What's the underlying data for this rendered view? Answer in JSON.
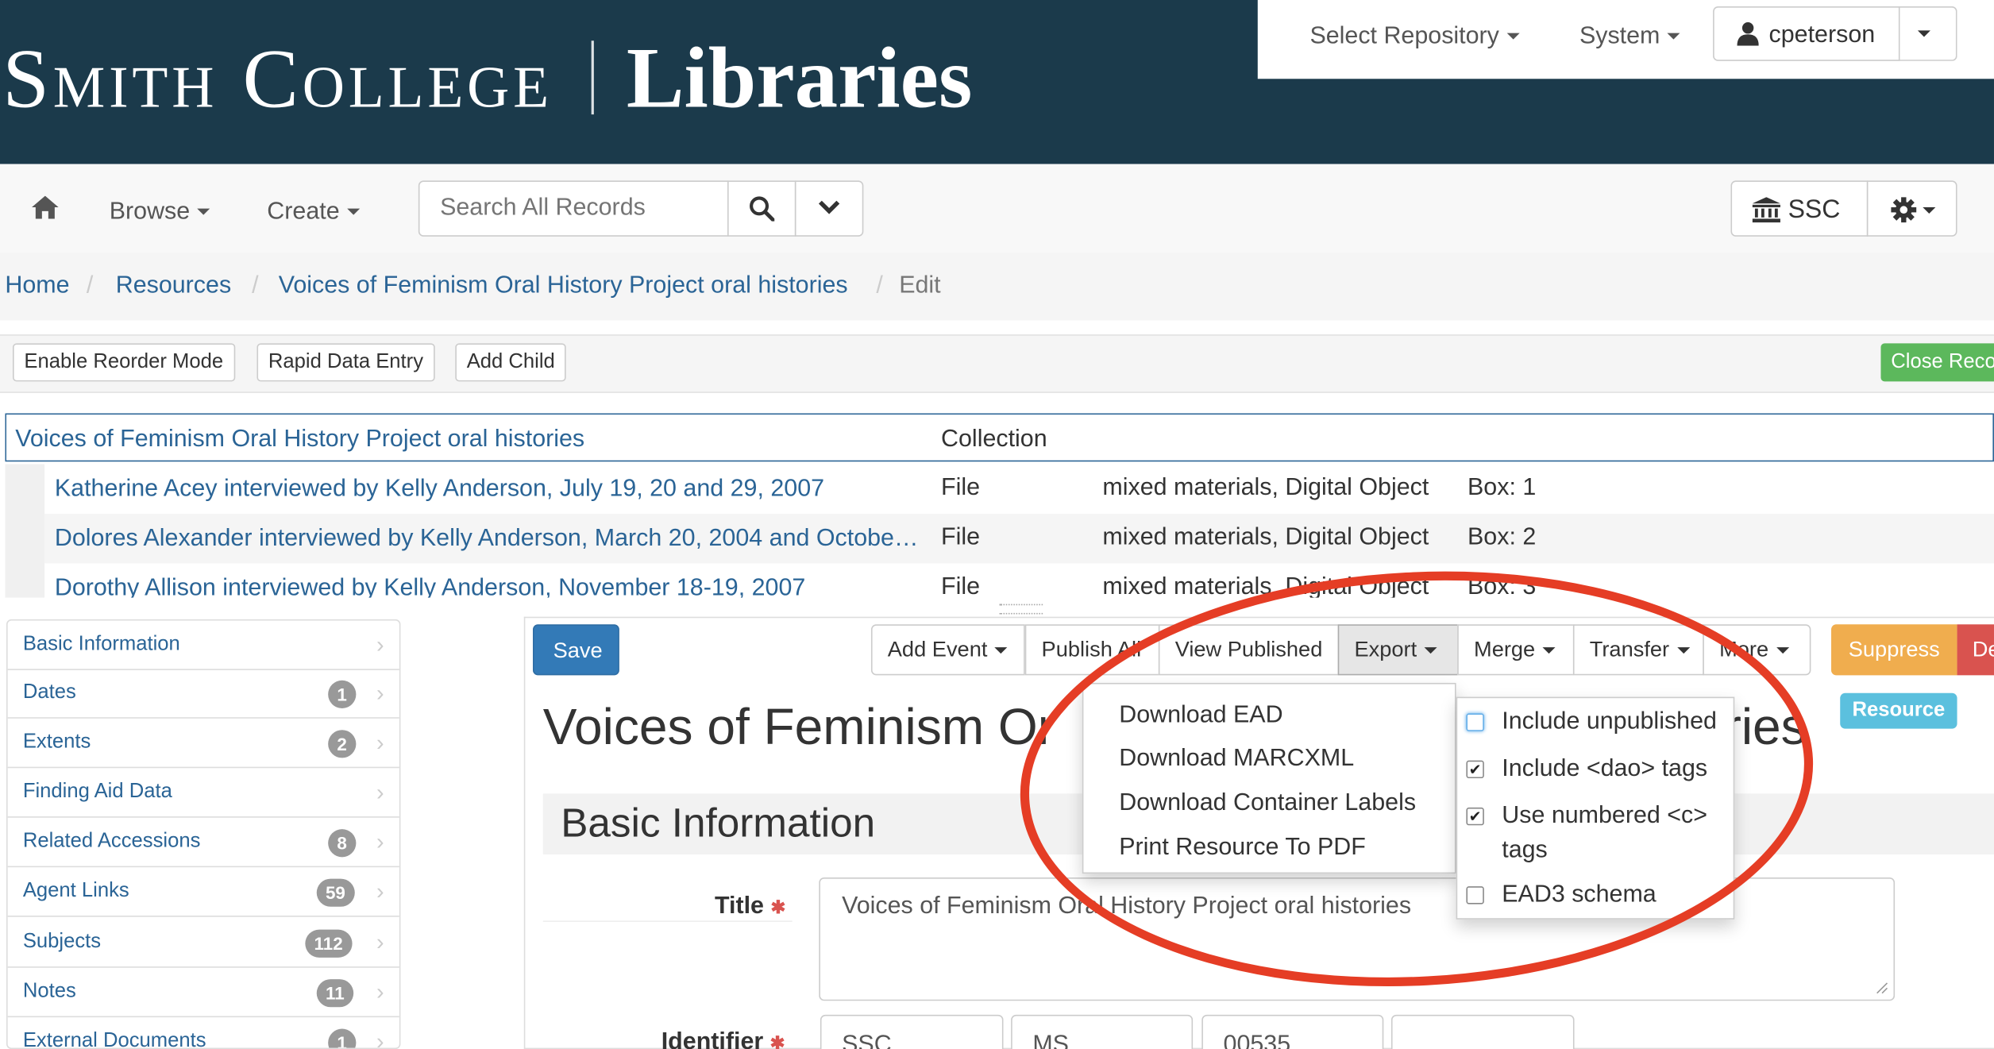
{
  "header": {
    "brand_college": "Smith College",
    "brand_libraries": "Libraries",
    "select_repository": "Select Repository",
    "system": "System",
    "user": "cpeterson"
  },
  "nav": {
    "browse": "Browse",
    "create": "Create",
    "search_placeholder": "Search All Records",
    "repo": "SSC"
  },
  "breadcrumb": [
    "Home",
    "Resources",
    "Voices of Feminism Oral History Project oral histories",
    "Edit"
  ],
  "toolbar": {
    "reorder": "Enable Reorder Mode",
    "rapid": "Rapid Data Entry",
    "add_child": "Add Child",
    "close_record": "Close Record"
  },
  "tree": {
    "root": {
      "title": "Voices of Feminism Oral History Project oral histories",
      "level": "Collection"
    },
    "rows": [
      {
        "title": "Katherine Acey interviewed by Kelly Anderson, July 19, 20 and 29, 2007",
        "level": "File",
        "type": "mixed materials, Digital Object",
        "container": "Box: 1"
      },
      {
        "title": "Dolores Alexander interviewed by Kelly Anderson, March 20, 2004 and Octobe…",
        "level": "File",
        "type": "mixed materials, Digital Object",
        "container": "Box: 2"
      },
      {
        "title": "Dorothy Allison interviewed by Kelly Anderson, November 18-19, 2007",
        "level": "File",
        "type": "mixed materials, Digital Object",
        "container": "Box: 3"
      }
    ]
  },
  "sidebar": {
    "items": [
      {
        "label": "Basic Information",
        "count": ""
      },
      {
        "label": "Dates",
        "count": "1"
      },
      {
        "label": "Extents",
        "count": "2"
      },
      {
        "label": "Finding Aid Data",
        "count": ""
      },
      {
        "label": "Related Accessions",
        "count": "8"
      },
      {
        "label": "Agent Links",
        "count": "59"
      },
      {
        "label": "Subjects",
        "count": "112"
      },
      {
        "label": "Notes",
        "count": "11"
      },
      {
        "label": "External Documents",
        "count": "1"
      }
    ]
  },
  "actions": {
    "save": "Save",
    "add_event": "Add Event",
    "publish_all": "Publish All",
    "view_published": "View Published",
    "export": "Export",
    "merge": "Merge",
    "transfer": "Transfer",
    "more": "More",
    "suppress": "Suppress",
    "delete": "Delete"
  },
  "record": {
    "tag": "Resource",
    "title_left": "Voices of Feminism Or",
    "title_right": "ries",
    "section": "Basic Information",
    "title_label": "Title",
    "title_value": "Voices of Feminism Oral History Project oral histories",
    "identifier_label": "Identifier",
    "identifier_parts": [
      "SSC",
      "MS",
      "00535",
      ""
    ]
  },
  "export_menu": {
    "items": [
      "Download EAD",
      "Download MARCXML",
      "Download Container Labels",
      "Print Resource To PDF"
    ],
    "options": [
      {
        "label": "Include unpublished",
        "checked": false
      },
      {
        "label": "Include <dao> tags",
        "checked": true
      },
      {
        "label": "Use numbered <c>",
        "label2": "tags",
        "checked": true
      },
      {
        "label": "EAD3 schema",
        "checked": false
      }
    ]
  },
  "colors": {
    "banner": "#1b3a4b",
    "link": "#2a6496",
    "primary": "#337ab7",
    "success": "#5cb85c",
    "warning": "#f0ad4e",
    "danger": "#d9534f",
    "info": "#5bc0de",
    "annotation": "#e53d25"
  }
}
